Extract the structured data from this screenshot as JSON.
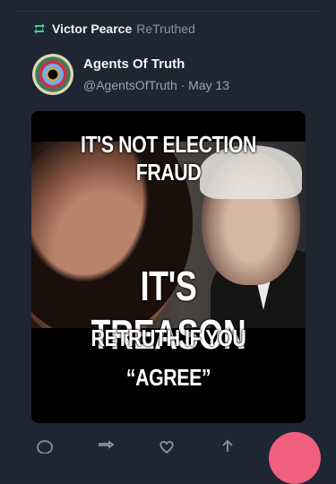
{
  "retruth": {
    "user": "Victor Pearce",
    "verb": "ReTruthed"
  },
  "post": {
    "author_name": "Agents Of Truth",
    "author_handle": "@AgentsOfTruth",
    "date": "May 13",
    "meta": "@AgentsOfTruth · May 13",
    "image_text": {
      "line1": "IT'S NOT ELECTION FRAUD",
      "line2": "IT'S TREASON",
      "line3": "RETRUTH IF YOU",
      "line4": "“AGREE”"
    }
  },
  "actions": [
    "reply-icon",
    "retruth-icon",
    "like-icon",
    "share-icon"
  ],
  "colors": {
    "background": "#1e2533",
    "fab": "#f0607e",
    "muted": "#8a93a6"
  }
}
